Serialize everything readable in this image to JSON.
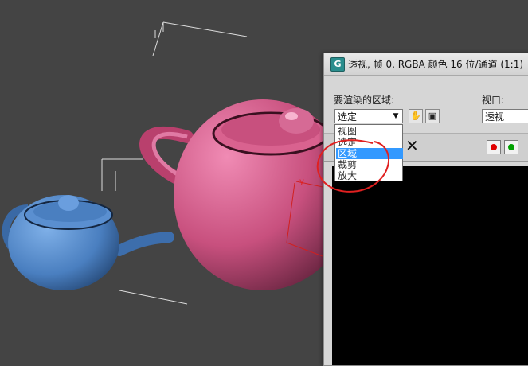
{
  "window": {
    "icon_letter": "G",
    "title": "透视, 帧 0, RGBA 颜色 16 位/通道 (1:1)"
  },
  "render_area": {
    "label": "要渲染的区域:",
    "selected": "选定",
    "options": [
      "视图",
      "选定",
      "区域",
      "裁剪",
      "放大"
    ],
    "highlighted_index": 2
  },
  "viewport": {
    "label": "视口:",
    "selected": "透视"
  },
  "toolbar": {
    "close_icon": "close-icon",
    "channels": [
      {
        "name": "red-channel",
        "color": "#e00000"
      },
      {
        "name": "green-channel",
        "color": "#00a000"
      }
    ]
  },
  "scene": {
    "teapot_colors": {
      "blue": "#4a7fc0",
      "pink": "#c8507e"
    },
    "gizmo_label": "y"
  },
  "annotation": {
    "circle_color": "#e02020"
  }
}
